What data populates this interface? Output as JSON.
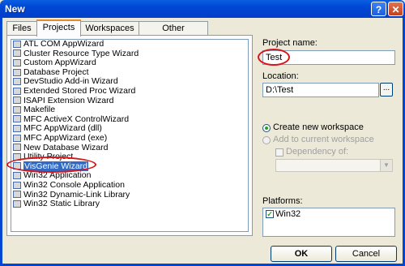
{
  "window": {
    "title": "New",
    "help_glyph": "?",
    "close_glyph": "✕"
  },
  "tabs": [
    "Files",
    "Projects",
    "Workspaces",
    "Other Documents"
  ],
  "active_tab": "Projects",
  "projects": [
    {
      "label": "ATL COM AppWizard",
      "icon": "atl-icon"
    },
    {
      "label": "Cluster Resource Type Wizard",
      "icon": "cluster-icon"
    },
    {
      "label": "Custom AppWizard",
      "icon": "wizard-icon"
    },
    {
      "label": "Database Project",
      "icon": "database-icon"
    },
    {
      "label": "DevStudio Add-in Wizard",
      "icon": "addin-icon"
    },
    {
      "label": "Extended Stored Proc Wizard",
      "icon": "storedproc-icon"
    },
    {
      "label": "ISAPI Extension Wizard",
      "icon": "isapi-icon"
    },
    {
      "label": "Makefile",
      "icon": "makefile-icon"
    },
    {
      "label": "MFC ActiveX ControlWizard",
      "icon": "activex-icon"
    },
    {
      "label": "MFC AppWizard (dll)",
      "icon": "mfc-dll-icon"
    },
    {
      "label": "MFC AppWizard (exe)",
      "icon": "mfc-exe-icon"
    },
    {
      "label": "New Database Wizard",
      "icon": "new-database-icon"
    },
    {
      "label": "Utility Project",
      "icon": "utility-icon"
    },
    {
      "label": "VisGenie Wizard",
      "icon": "visgenie-icon"
    },
    {
      "label": "Win32 Application",
      "icon": "win32-app-icon"
    },
    {
      "label": "Win32 Console Application",
      "icon": "console-icon"
    },
    {
      "label": "Win32 Dynamic-Link Library",
      "icon": "dll-icon"
    },
    {
      "label": "Win32 Static Library",
      "icon": "lib-icon"
    }
  ],
  "selected_project": "VisGenie Wizard",
  "project_name": {
    "label": "Project name:",
    "value": "Test"
  },
  "location": {
    "label": "Location:",
    "value": "D:\\Test",
    "browse": "..."
  },
  "workspace": {
    "create_new": "Create new workspace",
    "add_current": "Add to current workspace",
    "dependency": "Dependency of:"
  },
  "platforms": {
    "label": "Platforms:",
    "items": [
      "Win32"
    ]
  },
  "buttons": {
    "ok": "OK",
    "cancel": "Cancel"
  },
  "colors": {
    "highlight_oval": "#d9131a",
    "selection": "#316ac5",
    "titlebar": "#0046d5"
  }
}
